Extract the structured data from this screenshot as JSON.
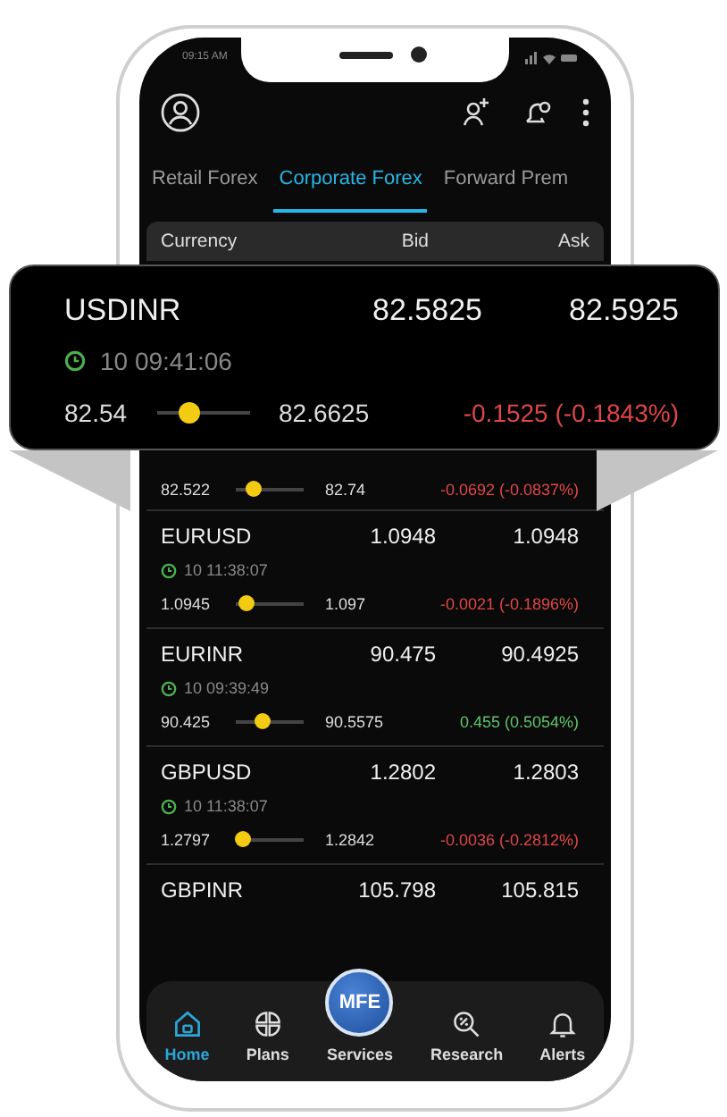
{
  "status_bar": {
    "time": "09:15 AM"
  },
  "tabs": [
    {
      "label": "Retail Forex",
      "selected": false
    },
    {
      "label": "Corporate Forex",
      "selected": true
    },
    {
      "label": "Forward Prem",
      "selected": false
    }
  ],
  "table": {
    "columns": [
      "Currency",
      "Bid",
      "Ask"
    ],
    "rows": [
      {
        "low": "82.522",
        "level": 0.25,
        "high": "82.74",
        "change": "-0.0692 (-0.0837%)",
        "color": "#e04646"
      },
      {
        "pair": "EURUSD",
        "bid": "1.0948",
        "ask": "1.0948",
        "time": "10 11:38:07",
        "low": "1.0945",
        "level": 0.15,
        "high": "1.097",
        "change": "-0.0021 (-0.1896%)",
        "color": "#e04646"
      },
      {
        "pair": "EURINR",
        "bid": "90.475",
        "ask": "90.4925",
        "time": "10 09:39:49",
        "low": "90.425",
        "level": 0.4,
        "high": "90.5575",
        "change": "0.455 (0.5054%)",
        "color": "#5cc46a"
      },
      {
        "pair": "GBPUSD",
        "bid": "1.2802",
        "ask": "1.2803",
        "time": "10 11:38:07",
        "low": "1.2797",
        "level": 0.1,
        "high": "1.2842",
        "change": "-0.0036 (-0.2812%)",
        "color": "#e04646"
      },
      {
        "pair": "GBPINR",
        "bid": "105.798",
        "ask": "105.815"
      }
    ]
  },
  "callout": {
    "pair": "USDINR",
    "bid": "82.5825",
    "ask": "82.5925",
    "time": "10 09:41:06",
    "low": "82.54",
    "level": 0.35,
    "high": "82.6625",
    "change": "-0.1525 (-0.1843%)",
    "color": "#e04646"
  },
  "bottom_nav": [
    {
      "label": "Home",
      "kind": "home",
      "selected": true
    },
    {
      "label": "Plans",
      "kind": "plans",
      "selected": false
    },
    {
      "label": "Services",
      "kind": "services",
      "badge": "MFE",
      "selected": false
    },
    {
      "label": "Research",
      "kind": "research",
      "selected": false
    },
    {
      "label": "Alerts",
      "kind": "alerts",
      "selected": false
    }
  ]
}
